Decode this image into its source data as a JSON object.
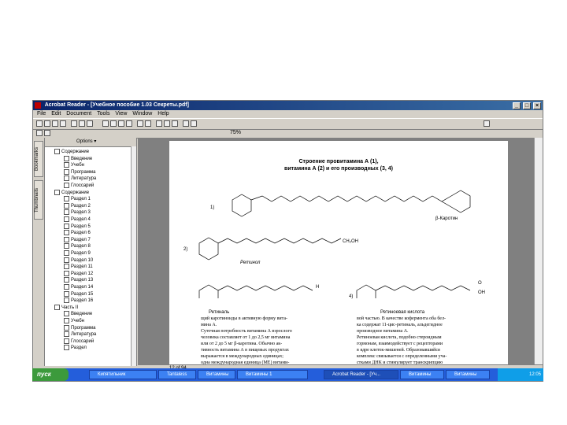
{
  "window": {
    "title": "Acrobat Reader - [Учебное пособие 1.03 Секреты.pdf]",
    "buttons": [
      "_",
      "□",
      "×"
    ]
  },
  "menu": [
    "File",
    "Edit",
    "Document",
    "Tools",
    "View",
    "Window",
    "Help"
  ],
  "toolbar2": {
    "zoom": "75%"
  },
  "side_tabs": [
    "Bookmarks",
    "Thumbnails"
  ],
  "nav": {
    "header": "Options",
    "tree": [
      {
        "label": "Содержание",
        "depth": 1
      },
      {
        "label": "Введение",
        "depth": 2
      },
      {
        "label": "Учебн",
        "depth": 2
      },
      {
        "label": "Программа",
        "depth": 2
      },
      {
        "label": "Литература",
        "depth": 2
      },
      {
        "label": "Глоссарий",
        "depth": 2
      },
      {
        "label": "Содержание",
        "depth": 1
      },
      {
        "label": "Раздел 1",
        "depth": 2
      },
      {
        "label": "Раздел 2",
        "depth": 2
      },
      {
        "label": "Раздел 3",
        "depth": 2
      },
      {
        "label": "Раздел 4",
        "depth": 2
      },
      {
        "label": "Раздел 5",
        "depth": 2
      },
      {
        "label": "Раздел 6",
        "depth": 2
      },
      {
        "label": "Раздел 7",
        "depth": 2
      },
      {
        "label": "Раздел 8",
        "depth": 2
      },
      {
        "label": "Раздел 9",
        "depth": 2
      },
      {
        "label": "Раздел 10",
        "depth": 2
      },
      {
        "label": "Раздел 11",
        "depth": 2
      },
      {
        "label": "Раздел 12",
        "depth": 2
      },
      {
        "label": "Раздел 13",
        "depth": 2
      },
      {
        "label": "Раздел 14",
        "depth": 2
      },
      {
        "label": "Раздел 15",
        "depth": 2
      },
      {
        "label": "Раздел 16",
        "depth": 2
      },
      {
        "label": "Часть II",
        "depth": 1
      },
      {
        "label": "Введение",
        "depth": 2
      },
      {
        "label": "Учебн",
        "depth": 2
      },
      {
        "label": "Программа",
        "depth": 2
      },
      {
        "label": "Литература",
        "depth": 2
      },
      {
        "label": "Глоссарий",
        "depth": 2
      },
      {
        "label": "Раздел",
        "depth": 2
      }
    ]
  },
  "page": {
    "title_line1": "Строение провитамина А (1),",
    "title_line2": "витамина А (2) и его производных (3, 4)",
    "label_1": "1)",
    "label_2": "2)",
    "label_4": "4)",
    "beta_carotene": "β-Каротин",
    "retinol": "Ретинол",
    "retinal": "Ретиналь",
    "retinoic_acid": "Ретиноевая кислота",
    "ch2oh": "CH₂OH",
    "cooh_h": "H",
    "cooh_o": "O",
    "cooh_oh": "OH",
    "text_left": [
      "щий каротиноиды в активную форму вита-",
      "мина А.",
      "Суточная потребность витамина А взрослого",
      "человека составляет от 1 до 2,5 мг витамина",
      "или от 2 до 5 мг β-каротина. Обычно ак-",
      "тивность витамина А в пищевых продуктах",
      "выражается в международных единицах;",
      "одна международная единица (МЕ) витами-"
    ],
    "text_right": [
      "вой частью. В качестве кофермента оба бел-",
      "ка содержат 11-цис-ретиналь, альдегидное",
      "производное витамина А.",
      "Ретиноевая кислота, подобно стероидным",
      "гормонам, взаимодействует с рецепторами",
      "в ядре клеток-мишеней. Образовавшийся",
      "комплекс связывается с определенными уча-",
      "стками ДНК и стимулирует транскрипцию"
    ]
  },
  "hscroll": {
    "page_indicator": "12 of 94"
  },
  "taskbar": {
    "start": "пуск",
    "items": [
      "Кипятильник",
      "Tantaless",
      "Витамины",
      "Витамины 1",
      "Acrobat Reader - [Уч...",
      "Витамины",
      "Витамины"
    ],
    "clock": "12:05"
  },
  "colors": {
    "titlebar": "#0a246a",
    "taskbar": "#245edb",
    "start": "#3c9a3c"
  }
}
